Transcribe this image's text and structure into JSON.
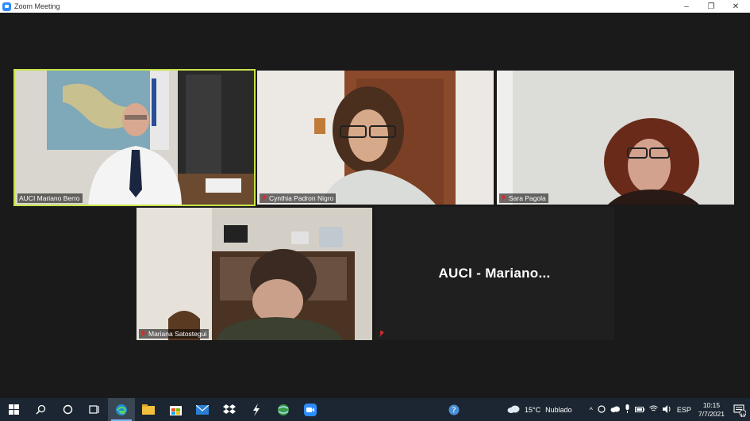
{
  "window": {
    "title": "Zoom Meeting",
    "minimize": "–",
    "restore": "❐",
    "close": "✕"
  },
  "participants": [
    {
      "name": "AUCI Mariano Berro"
    },
    {
      "name": "Cynthia Padron Nigro"
    },
    {
      "name": "Sara Pagola"
    },
    {
      "name": "Mariana Satostegui"
    }
  ],
  "no_video_tile": {
    "label": "AUCI - Mariano..."
  },
  "taskbar": {
    "weather_temp": "15°C",
    "weather_desc": "Nublado",
    "language": "ESP",
    "time": "10:15",
    "date": "7/7/2021",
    "notification_count": "11"
  }
}
